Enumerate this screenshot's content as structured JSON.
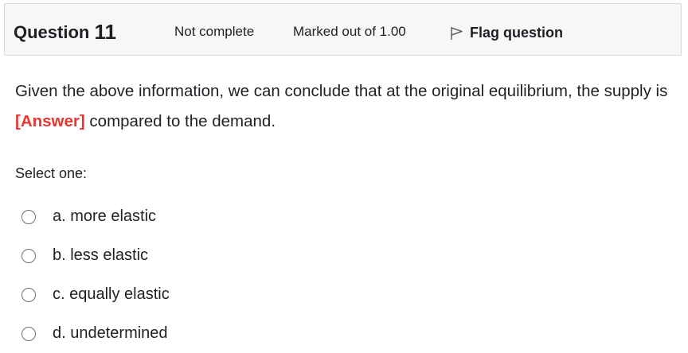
{
  "header": {
    "question_word": "Question",
    "question_number": "11",
    "state": "Not complete",
    "grade": "Marked out of 1.00",
    "flag_label": "Flag question"
  },
  "question": {
    "text_before": "Given the above information, we can conclude that at the original equilibrium, the supply is ",
    "answer_token": "[Answer]",
    "text_after": " compared to the demand."
  },
  "prompt": "Select one:",
  "options": [
    {
      "label": "a. more elastic",
      "selected": false
    },
    {
      "label": "b. less elastic",
      "selected": false
    },
    {
      "label": "c. equally elastic",
      "selected": false
    },
    {
      "label": "d. undetermined",
      "selected": false
    }
  ],
  "icons": {
    "flag": "flag-icon",
    "radio": "radio-unchecked-icon"
  },
  "colors": {
    "accent_answer": "#e8352e",
    "header_bg": "#f7f7f7",
    "text": "#1d2125"
  }
}
